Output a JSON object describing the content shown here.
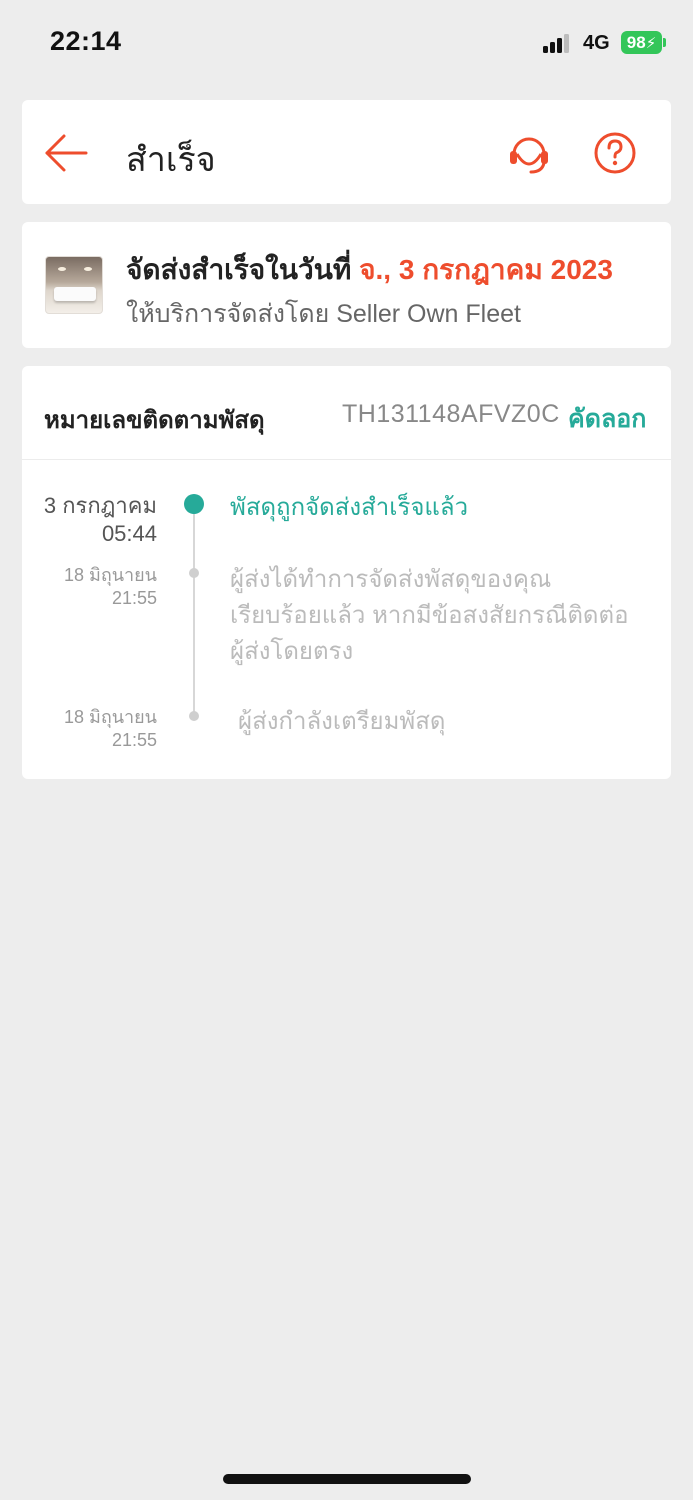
{
  "status_bar": {
    "time": "22:14",
    "network": "4G",
    "battery": "98"
  },
  "header": {
    "title": "สำเร็จ",
    "icons": {
      "back": "back-arrow-icon",
      "support": "headset-icon",
      "help": "help-circle-icon"
    }
  },
  "delivery": {
    "prefix": "จัดส่งสำเร็จในวันที่ ",
    "date": "จ., 3 กรกฎาคม 2023",
    "provider": "ให้บริการจัดส่งโดย Seller Own Fleet"
  },
  "tracking": {
    "label": "หมายเลขติดตามพัสดุ",
    "number": "TH131148AFVZ0C",
    "copy_label": "คัดลอก"
  },
  "events": [
    {
      "date": "3 กรกฎาคม",
      "time": "05:44",
      "text": "พัสดุถูกจัดส่งสำเร็จแล้ว",
      "active": true
    },
    {
      "date": "18 มิถุนายน",
      "time": "21:55",
      "text_lines": [
        "ผู้ส่งได้ทำการจัดส่งพัสดุของคุณ",
        "เรียบร้อยแล้ว หากมีข้อสงสัยกรณีติดต่อ",
        "ผู้ส่งโดยตรง"
      ],
      "active": false
    },
    {
      "date": "18 มิถุนายน",
      "time": "21:55",
      "text": "ผู้ส่งกำลังเตรียมพัสดุ",
      "active": false
    }
  ],
  "colors": {
    "accent": "#ee4d2d",
    "success": "#26aa99",
    "background": "#ededed"
  }
}
